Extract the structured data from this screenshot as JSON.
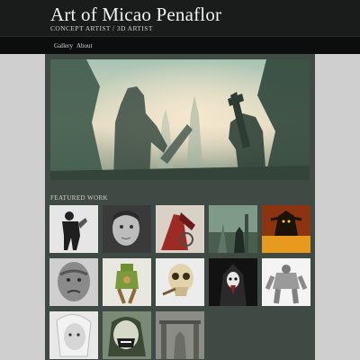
{
  "site": {
    "title": "Art of Micao Penaflor",
    "tagline": "CONCEPT ARTIST / 3D ARTIST"
  },
  "nav": {
    "items": [
      {
        "label": "Gallery"
      },
      {
        "label": "About"
      }
    ]
  },
  "featured": {
    "heading": "FEATURED WORK"
  },
  "colors": {
    "header_bg": "#1a1c1b",
    "nav_bg": "#0c0d0d",
    "content_bg": "#3e4a43",
    "page_bg": "#cfcfcf"
  }
}
